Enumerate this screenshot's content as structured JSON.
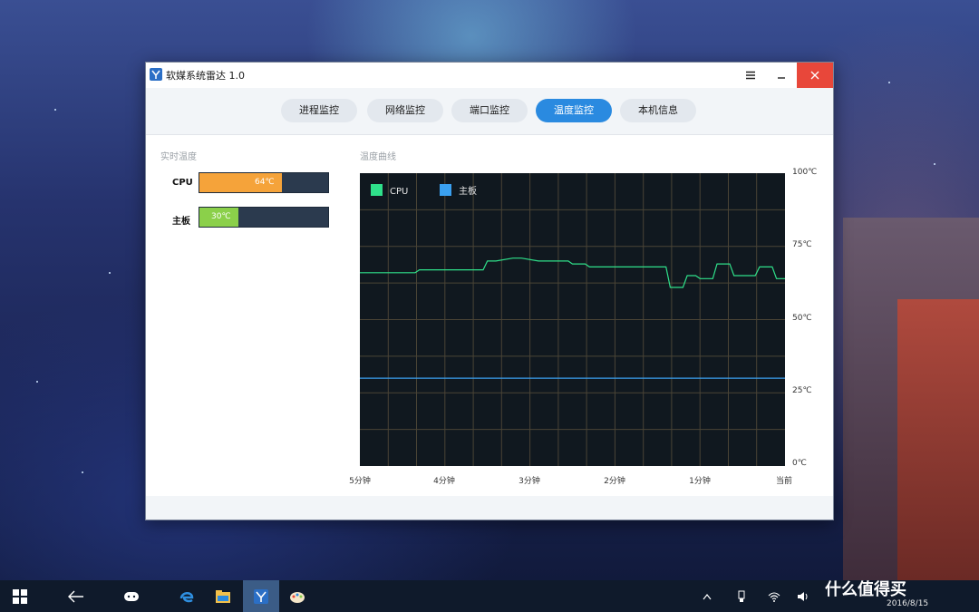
{
  "window": {
    "title": "软媒系统雷达 1.0"
  },
  "tabs": [
    {
      "label": "进程监控",
      "active": false
    },
    {
      "label": "网络监控",
      "active": false
    },
    {
      "label": "端口监控",
      "active": false
    },
    {
      "label": "温度监控",
      "active": true
    },
    {
      "label": "本机信息",
      "active": false
    }
  ],
  "realtime": {
    "section_label": "实时温度",
    "items": [
      {
        "label": "CPU",
        "value_text": "64℃",
        "value": 64,
        "color": "#f5a33a"
      },
      {
        "label": "主板",
        "value_text": "30℃",
        "value": 30,
        "color": "#8bd04a"
      }
    ]
  },
  "curve": {
    "section_label": "温度曲线"
  },
  "chart_data": {
    "type": "line",
    "legend": [
      "CPU",
      "主板"
    ],
    "series": [
      {
        "name": "CPU",
        "color": "#2fe08a",
        "x": [
          -5.0,
          -4.35,
          -4.3,
          -3.55,
          -3.5,
          -3.4,
          -3.2,
          -3.1,
          -2.9,
          -2.55,
          -2.5,
          -2.35,
          -2.3,
          -1.95,
          -1.85,
          -1.4,
          -1.35,
          -1.2,
          -1.15,
          -1.05,
          -1.0,
          -0.85,
          -0.8,
          -0.65,
          -0.6,
          -0.35,
          -0.3,
          -0.15,
          -0.1,
          0.0
        ],
        "values": [
          66,
          66,
          67,
          67,
          70,
          70,
          71,
          71,
          70,
          70,
          69,
          69,
          68,
          68,
          68,
          68,
          61,
          61,
          65,
          65,
          64,
          64,
          69,
          69,
          65,
          65,
          68,
          68,
          64,
          64
        ]
      },
      {
        "name": "主板",
        "color": "#3aa0f0",
        "x": [
          -5.0,
          0.0
        ],
        "values": [
          30,
          30
        ]
      }
    ],
    "xlim": [
      -5,
      0
    ],
    "ylim": [
      0,
      100
    ],
    "y_ticks": [
      "100℃",
      "75℃",
      "50℃",
      "25℃",
      "0℃"
    ],
    "x_ticks": [
      "5分钟",
      "4分钟",
      "3分钟",
      "2分钟",
      "1分钟",
      "当前"
    ],
    "grid": true,
    "legend_position": "top-left"
  },
  "taskbar": {
    "date": "2016/8/15"
  },
  "watermark": "什么值得买"
}
